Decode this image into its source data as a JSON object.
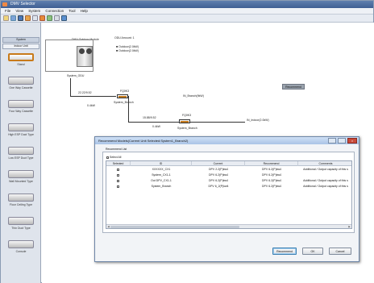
{
  "window": {
    "title": "DMV Selector"
  },
  "menu": [
    "File",
    "View",
    "System",
    "Connection",
    "Tool",
    "Help"
  ],
  "sidebar": {
    "tabs": [
      "System",
      "Indoor Unit"
    ],
    "items": [
      {
        "label": "Stand"
      },
      {
        "label": "One Way Cassette"
      },
      {
        "label": "Four Way Cassette"
      },
      {
        "label": "High ESP Duct Type"
      },
      {
        "label": "Low ESP Duct Type"
      },
      {
        "label": "Wall Mounted Type"
      },
      {
        "label": "Floor Ceiling Type"
      },
      {
        "label": "Thin Duct Type"
      },
      {
        "label": "Console"
      }
    ]
  },
  "canvas": {
    "unit_label": "DMV Outdoor Module",
    "odu_status": "ODU Amount: 1",
    "odu_info": [
      "■ Outdoor(2.0kW)",
      "■ Outdoor(2.0kW)"
    ],
    "system_label": "System_ODU",
    "pipe1": "22.22/9.52",
    "pipe1b": "0.4kW",
    "branch1": "FQ0K3",
    "branch1_sub": "System_Branch",
    "remark": "IN_Branch(9kW)",
    "pipe2": "15.88/9.52",
    "pipe2b": "0.4kW",
    "branch2": "FQ0K3",
    "branch2_sub": "System_Branch",
    "indoor_right": "IN_Indoor(2.0kW)",
    "float_btn": "Recommend"
  },
  "dialog": {
    "title": "Recommend Models(Current Unit Selected:System1_Branch2)",
    "group_label": "Recommend List",
    "select_all": "Select All",
    "columns": [
      "Selected",
      "ID",
      "Current",
      "Recommend",
      "Comments"
    ],
    "rows": [
      {
        "id": "XXXXXX_CX1",
        "current": "DPV 2.2(P)kw4",
        "recommend": "DPV 6.2(P)kw4",
        "comments": "Additional / Output capacity of this s"
      },
      {
        "id": "System_CX1-1",
        "current": "DPV 6.2(P)kw4",
        "recommend": "DPV 6.2(P)kw4",
        "comments": ""
      },
      {
        "id": "Out DPV_CX1-1",
        "current": "DPV 6.2(P)kw4",
        "recommend": "DPV 6.2(P)kw4",
        "comments": "Additional / Output capacity of this s"
      },
      {
        "id": "System_Branch",
        "current": "DPV 6_2(P)kw4",
        "recommend": "DPV 6.2(P)kw4",
        "comments": "Additional / Output capacity of this s"
      }
    ],
    "buttons": {
      "recommend": "Recommend",
      "ok": "OK",
      "cancel": "Cancel"
    }
  }
}
